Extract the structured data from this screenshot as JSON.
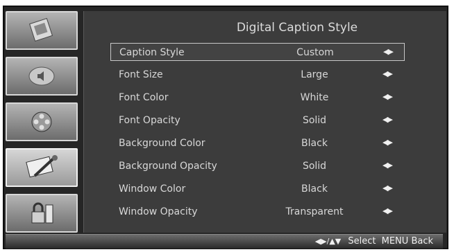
{
  "menu": {
    "title": "Digital Caption Style",
    "rows": [
      {
        "label": "Caption Style",
        "value": "Custom",
        "arrows": "◀▶"
      },
      {
        "label": "Font Size",
        "value": "Large",
        "arrows": "◀▶"
      },
      {
        "label": "Font Color",
        "value": "White",
        "arrows": "◀▶"
      },
      {
        "label": "Font Opacity",
        "value": "Solid",
        "arrows": "◀▶"
      },
      {
        "label": "Background Color",
        "value": "Black",
        "arrows": "◀▶"
      },
      {
        "label": "Background Opacity",
        "value": "Solid",
        "arrows": "◀▶"
      },
      {
        "label": "Window Color",
        "value": "Black",
        "arrows": "◀▶"
      },
      {
        "label": "Window Opacity",
        "value": "Transparent",
        "arrows": "◀▶"
      }
    ]
  },
  "sidebar": {
    "tabs": [
      {
        "icon": "picture-icon"
      },
      {
        "icon": "audio-icon"
      },
      {
        "icon": "channel-reel-icon"
      },
      {
        "icon": "setup-tools-icon"
      },
      {
        "icon": "lock-icon"
      }
    ]
  },
  "footer": {
    "nav_glyph": "◀▶/▲▼",
    "select_label": "Select",
    "menu_key": "MENU",
    "back_label": "Back"
  }
}
